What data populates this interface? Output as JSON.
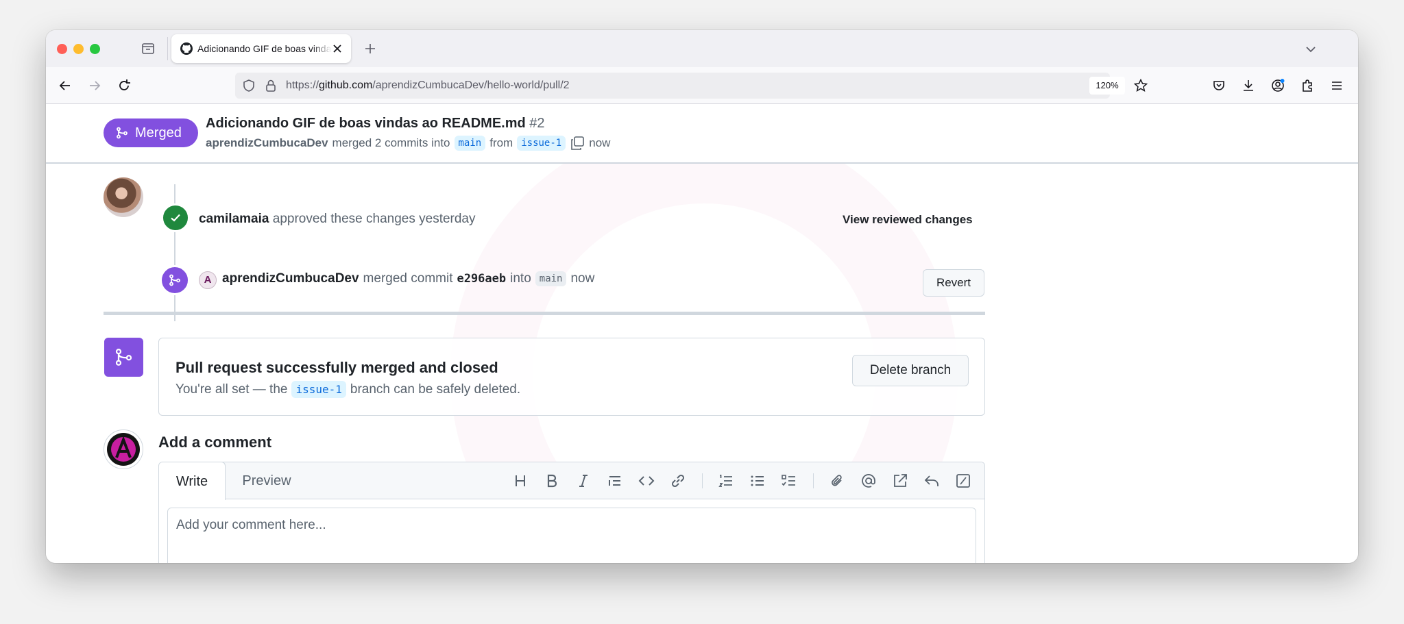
{
  "browser": {
    "tab_title": "Adicionando GIF de boas vindas ao README.md",
    "url_scheme": "https://",
    "url_host": "github.com",
    "url_path": "/aprendizCumbucaDev/hello-world/pull/2",
    "zoom": "120%"
  },
  "header": {
    "state_label": "Merged",
    "title": "Adicionando GIF de boas vindas ao README.md",
    "number": "#2",
    "author": "aprendizCumbucaDev",
    "merged_text": "merged 2 commits into",
    "base_branch": "main",
    "from_text": "from",
    "head_branch": "issue-1",
    "time": "now"
  },
  "timeline": {
    "review": {
      "user": "camilamaia",
      "text": "approved these changes yesterday",
      "action_label": "View reviewed changes"
    },
    "merge_event": {
      "user": "aprendizCumbucaDev",
      "text": "merged commit",
      "sha": "e296aeb",
      "into_text": "into",
      "branch": "main",
      "time": "now",
      "revert_label": "Revert"
    }
  },
  "merged_box": {
    "title": "Pull request successfully merged and closed",
    "sub_before": "You're all set — the",
    "branch": "issue-1",
    "sub_after": "branch can be safely deleted.",
    "delete_label": "Delete branch"
  },
  "comment": {
    "heading": "Add a comment",
    "tab_write": "Write",
    "tab_preview": "Preview",
    "placeholder": "Add your comment here..."
  },
  "avatar_letters": {
    "mini": "A"
  },
  "colors": {
    "merged_purple": "#8250df",
    "approved_green": "#1f883d",
    "link_blue": "#0969da"
  },
  "icons": {
    "toolbar": [
      "heading-icon",
      "bold-icon",
      "italic-icon",
      "quote-icon",
      "code-icon",
      "link-icon",
      "ordered-list-icon",
      "unordered-list-icon",
      "task-list-icon",
      "attach-icon",
      "mention-icon",
      "cross-reference-icon",
      "saved-reply-icon",
      "slash-command-icon"
    ]
  }
}
